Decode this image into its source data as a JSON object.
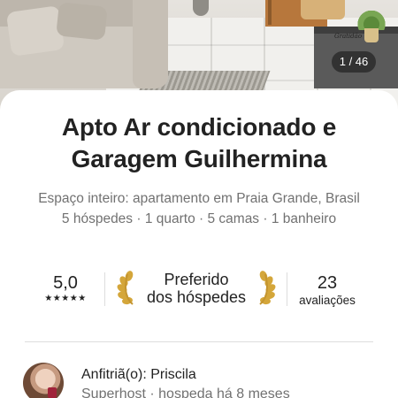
{
  "gallery": {
    "counter": "1 / 46",
    "sign_text": "Gratidão"
  },
  "listing": {
    "title_line1": "Apto Ar condicionado e",
    "title_line2": "Garagem Guilhermina",
    "subtitle_line1": "Espaço inteiro: apartamento em Praia Grande, Brasil",
    "subtitle_line2": "5 hóspedes · 1 quarto · 5 camas · 1 banheiro"
  },
  "stats": {
    "rating": "5,0",
    "stars": "★★★★★",
    "star_count": 5,
    "favorite_line1": "Preferido",
    "favorite_line2": "dos hóspedes",
    "reviews_count": "23",
    "reviews_label": "avaliações"
  },
  "host": {
    "name": "Anfitriã(o): Priscila",
    "subtitle": "Superhost · hospeda há 8 meses"
  },
  "colors": {
    "text_primary": "#222222",
    "text_secondary": "#717171",
    "laurel_gold": "#d4a63a",
    "divider": "#dddddd"
  }
}
